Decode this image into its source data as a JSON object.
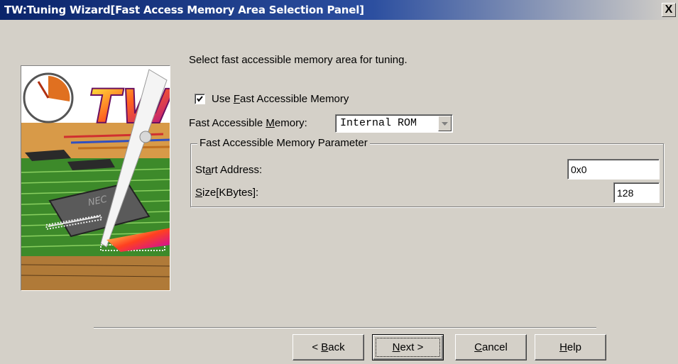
{
  "window": {
    "title": "TW:Tuning Wizard[Fast Access Memory Area Selection Panel]",
    "close_glyph": "X"
  },
  "banner": {
    "logo_text": "TW",
    "chip_label": "NEC"
  },
  "content": {
    "instruction": "Select fast accessible memory area for tuning.",
    "use_fast_memory": {
      "label_pre": "Use ",
      "mnemonic": "F",
      "label_post": "ast Accessible Memory",
      "checked": true
    },
    "memory_select": {
      "label_pre": "Fast Accessible ",
      "mnemonic": "M",
      "label_post": "emory:",
      "value": "Internal ROM"
    },
    "parameter_group": {
      "title": "Fast Accessible Memory Parameter",
      "start_address": {
        "label_pre": "St",
        "mnemonic": "a",
        "label_post": "rt Address:",
        "value": "0x0"
      },
      "size": {
        "label_pre": "",
        "mnemonic": "S",
        "label_post": "ize[KBytes]:",
        "value": "128"
      }
    }
  },
  "buttons": {
    "back": {
      "pre": "< ",
      "mnemonic": "B",
      "post": "ack"
    },
    "next": {
      "pre": "",
      "mnemonic": "N",
      "post": "ext >"
    },
    "cancel": {
      "pre": "",
      "mnemonic": "C",
      "post": "ancel"
    },
    "help": {
      "pre": "",
      "mnemonic": "H",
      "post": "elp"
    }
  },
  "colors": {
    "titlebar_start": "#0a246a",
    "dialog_bg": "#d4d0c8"
  },
  "icons": {
    "close": "close-icon",
    "checkbox": "checkmark-icon",
    "dropdown": "chevron-down-icon"
  }
}
